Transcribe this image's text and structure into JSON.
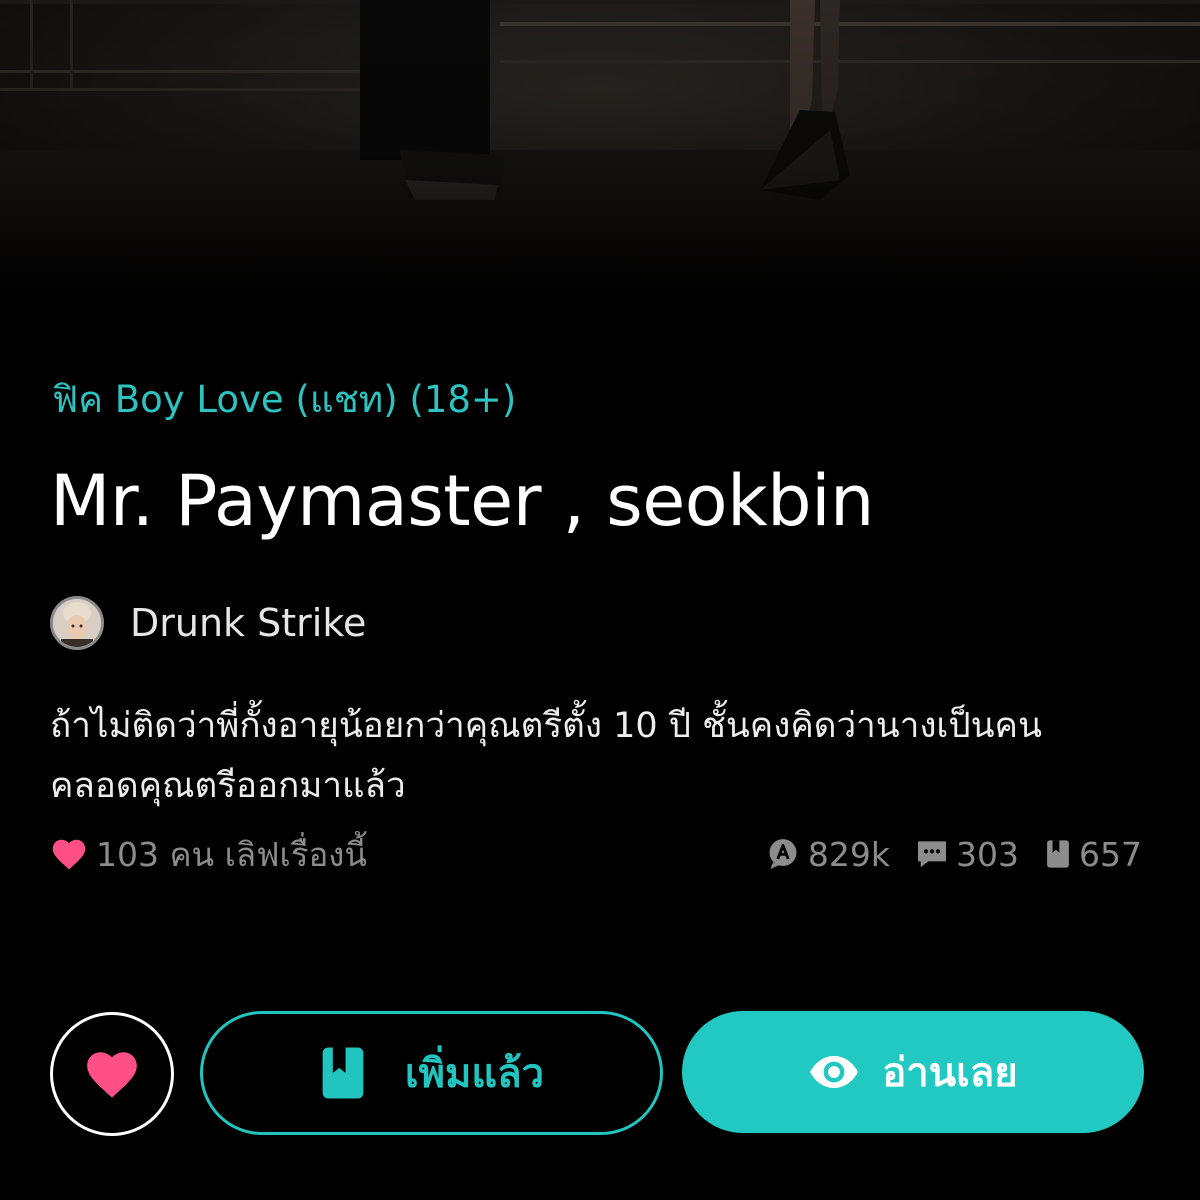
{
  "story": {
    "category": "ฟิค Boy Love (แชท) (18+)",
    "title": "Mr. Paymaster , seokbin",
    "author": {
      "name": "Drunk Strike",
      "avatar_icon": "author-avatar"
    },
    "synopsis": [
      "ถ้าไม่ติดว่าพี่กั้งอายุน้อยกว่าคุณตรีตั้ง 10 ปี ชั้นคงคิดว่านางเป็นคน",
      "คลอดคุณตรีออกมาแล้ว"
    ]
  },
  "stats": {
    "likes_text": "103 คน เลิฟเรื่องนี้",
    "reads": "829k",
    "comments": "303",
    "chapters": "657"
  },
  "actions": {
    "added_label": "เพิ่มแล้ว",
    "read_label": "อ่านเลย"
  },
  "icons": {
    "heart": "heart-icon",
    "reads": "reads-icon",
    "comments": "comment-icon",
    "chapters": "book-icon",
    "bookmark": "bookmark-icon",
    "eye": "eye-icon"
  },
  "colors": {
    "accent": "#21c4bf",
    "heart": "#ff4f87",
    "background": "#000000",
    "muted_text": "#8c8c8c"
  }
}
